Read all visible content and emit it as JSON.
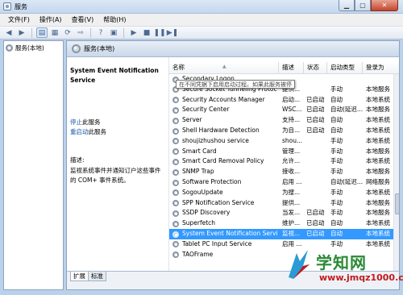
{
  "window": {
    "title": "服务"
  },
  "menu": [
    "文件(F)",
    "操作(A)",
    "查看(V)",
    "帮助(H)"
  ],
  "tree": {
    "root_label": "服务(本地)"
  },
  "main": {
    "header_label": "服务(本地)"
  },
  "description": {
    "service_name": "System Event Notification Service",
    "stop_link": "停止",
    "stop_suffix": "此服务",
    "restart_link": "重启动",
    "restart_suffix": "此服务",
    "desc_label": "描述:",
    "desc_text": "监视系统事件并通知订户这些事件的 COM+ 事件系统。"
  },
  "columns": [
    "名称",
    "描述",
    "状态",
    "启动类型",
    "登录为"
  ],
  "tooltip": "在不同凭据下启用启动过程。如果此服务被停",
  "rows": [
    {
      "name": "Secondary Logon",
      "desc": "",
      "status": "",
      "startup": "",
      "logon": ""
    },
    {
      "name": "Secure Socket Tunneling Protoco...",
      "desc": "提供...",
      "status": "",
      "startup": "手动",
      "logon": "本地服务"
    },
    {
      "name": "Security Accounts Manager",
      "desc": "启动...",
      "status": "已启动",
      "startup": "自动",
      "logon": "本地系统"
    },
    {
      "name": "Security Center",
      "desc": "WSC...",
      "status": "已启动",
      "startup": "自动(延迟...",
      "logon": "本地服务"
    },
    {
      "name": "Server",
      "desc": "支持...",
      "status": "已启动",
      "startup": "自动",
      "logon": "本地系统"
    },
    {
      "name": "Shell Hardware Detection",
      "desc": "为自...",
      "status": "已启动",
      "startup": "自动",
      "logon": "本地系统"
    },
    {
      "name": "shoujizhushou service",
      "desc": "shou...",
      "status": "",
      "startup": "手动",
      "logon": "本地系统"
    },
    {
      "name": "Smart Card",
      "desc": "管理...",
      "status": "",
      "startup": "手动",
      "logon": "本地服务"
    },
    {
      "name": "Smart Card Removal Policy",
      "desc": "允许...",
      "status": "",
      "startup": "手动",
      "logon": "本地系统"
    },
    {
      "name": "SNMP Trap",
      "desc": "接收...",
      "status": "",
      "startup": "手动",
      "logon": "本地服务"
    },
    {
      "name": "Software Protection",
      "desc": "启用 ...",
      "status": "",
      "startup": "自动(延迟...",
      "logon": "网络服务"
    },
    {
      "name": "SogouUpdate",
      "desc": "为搜...",
      "status": "",
      "startup": "手动",
      "logon": "本地系统"
    },
    {
      "name": "SPP Notification Service",
      "desc": "提供...",
      "status": "",
      "startup": "手动",
      "logon": "本地服务"
    },
    {
      "name": "SSDP Discovery",
      "desc": "当发...",
      "status": "已启动",
      "startup": "手动",
      "logon": "本地服务"
    },
    {
      "name": "Superfetch",
      "desc": "维护...",
      "status": "已启动",
      "startup": "自动",
      "logon": "本地系统"
    },
    {
      "name": "System Event Notification Service",
      "desc": "监视...",
      "status": "已启动",
      "startup": "自动",
      "logon": "本地系统",
      "selected": true
    },
    {
      "name": "Tablet PC Input Service",
      "desc": "启用 ...",
      "status": "",
      "startup": "手动",
      "logon": "本地系统"
    },
    {
      "name": "TAOFrame",
      "desc": "",
      "status": "",
      "startup": "",
      "logon": ""
    }
  ],
  "tabs": [
    "扩展",
    "标准"
  ],
  "watermark": {
    "brand": "学知网",
    "url": "www.jmqz1000.com"
  },
  "colors": {
    "selection": "#3399ff",
    "link": "#1a5aa6",
    "watermark_green": "#2a8a35",
    "watermark_red": "#c21b1b"
  }
}
